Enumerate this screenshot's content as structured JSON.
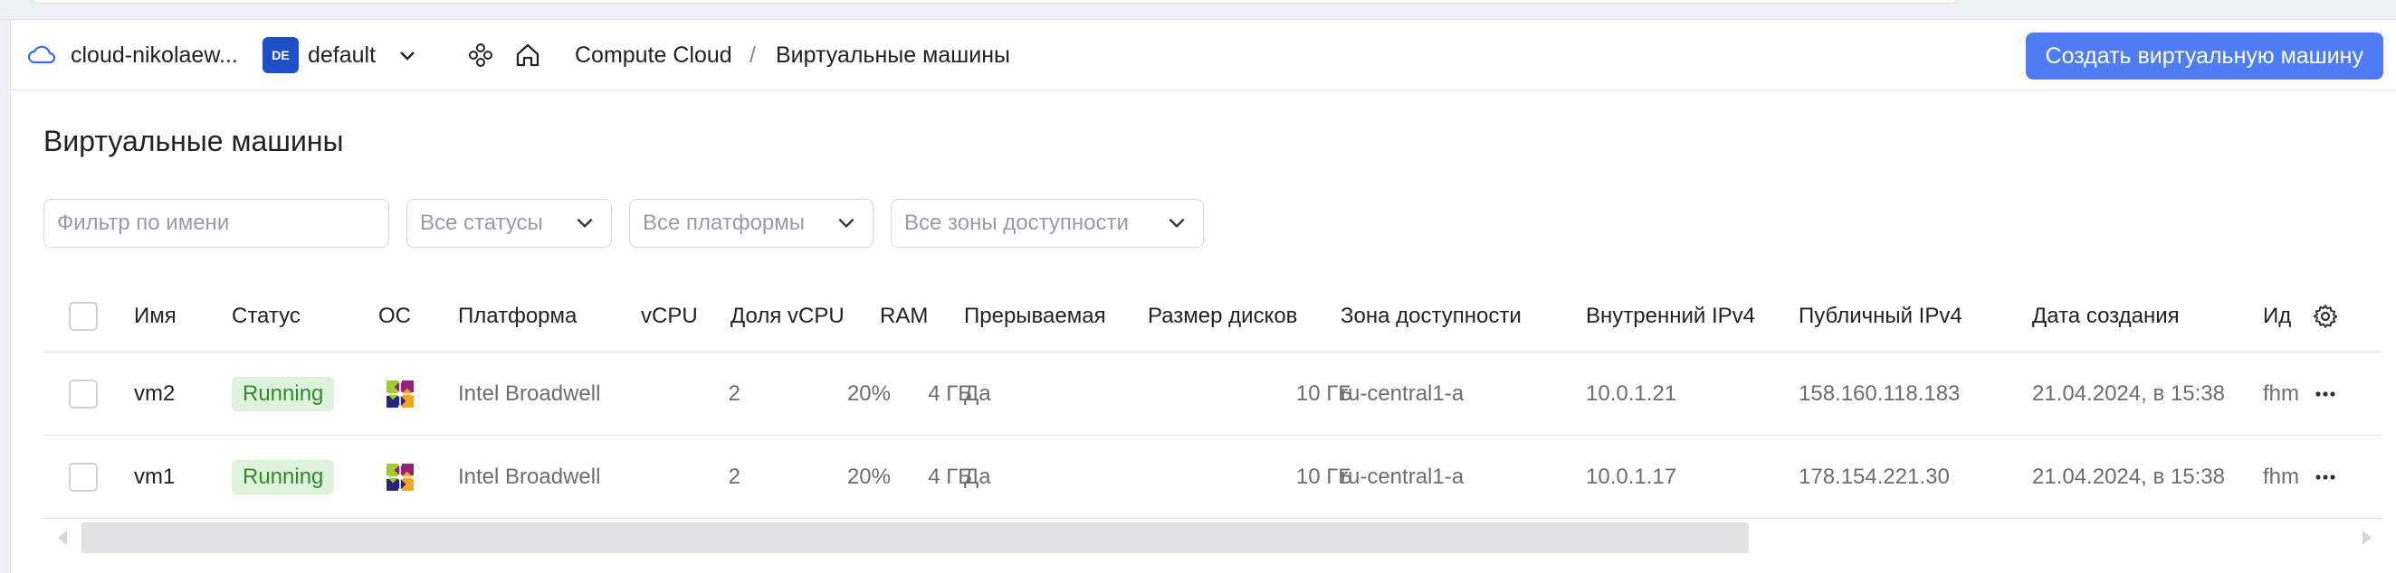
{
  "header": {
    "cloud_name": "cloud-nikolaew...",
    "folder_badge": "DE",
    "folder_name": "default",
    "breadcrumb": [
      "Compute Cloud",
      "/",
      "Виртуальные машины"
    ],
    "create_button": "Создать виртуальную машину"
  },
  "page": {
    "title": "Виртуальные машины"
  },
  "filters": {
    "name_placeholder": "Фильтр по имени",
    "status": "Все статусы",
    "platform": "Все платформы",
    "zone": "Все зоны доступности"
  },
  "table": {
    "columns": [
      "Имя",
      "Статус",
      "ОС",
      "Платформа",
      "vCPU",
      "Доля vCPU",
      "RAM",
      "Прерываемая",
      "Размер дисков",
      "Зона доступности",
      "Внутренний IPv4",
      "Публичный IPv4",
      "Дата создания",
      "Ид"
    ],
    "rows": [
      {
        "name": "vm2",
        "status": "Running",
        "os_icon": "centos-icon",
        "platform": "Intel Broadwell",
        "vcpu": "2",
        "vcpu_fraction": "20%",
        "ram": "4 ГБ",
        "preemptible": "Да",
        "disk": "10 ГБ",
        "zone": "ru-central1-a",
        "internal_ip": "10.0.1.21",
        "public_ip": "158.160.118.183",
        "created": "21.04.2024, в 15:38",
        "id": "fhm"
      },
      {
        "name": "vm1",
        "status": "Running",
        "os_icon": "centos-icon",
        "platform": "Intel Broadwell",
        "vcpu": "2",
        "vcpu_fraction": "20%",
        "ram": "4 ГБ",
        "preemptible": "Да",
        "disk": "10 ГБ",
        "zone": "ru-central1-a",
        "internal_ip": "10.0.1.17",
        "public_ip": "178.154.221.30",
        "created": "21.04.2024, в 15:38",
        "id": "fhm"
      }
    ]
  },
  "colors": {
    "accent": "#4d7cf5",
    "status_running_bg": "#dff3dc",
    "status_running_fg": "#2f8a2a"
  }
}
